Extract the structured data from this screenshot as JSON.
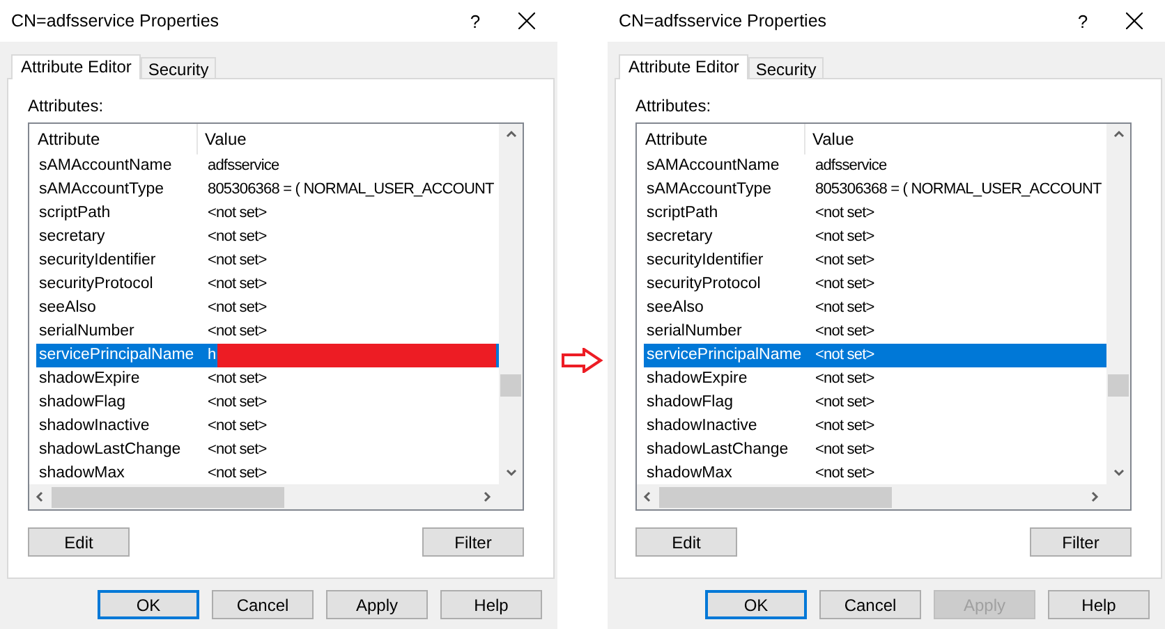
{
  "dialogs": [
    {
      "title": "CN=adfsservice Properties",
      "help": "?",
      "tabs": [
        {
          "label": "Attribute Editor",
          "selected": true
        },
        {
          "label": "Security",
          "selected": false
        }
      ],
      "attributes_label": "Attributes:",
      "columns": [
        "Attribute",
        "Value"
      ],
      "rows": [
        {
          "attribute": "sAMAccountName",
          "value": "adfsservice",
          "selected": false
        },
        {
          "attribute": "sAMAccountType",
          "value": "805306368 = ( NORMAL_USER_ACCOUNT",
          "selected": false
        },
        {
          "attribute": "scriptPath",
          "value": "<not set>",
          "selected": false
        },
        {
          "attribute": "secretary",
          "value": "<not set>",
          "selected": false
        },
        {
          "attribute": "securityIdentifier",
          "value": "<not set>",
          "selected": false
        },
        {
          "attribute": "securityProtocol",
          "value": "<not set>",
          "selected": false
        },
        {
          "attribute": "seeAlso",
          "value": "<not set>",
          "selected": false
        },
        {
          "attribute": "serialNumber",
          "value": "<not set>",
          "selected": false
        },
        {
          "attribute": "servicePrincipalName",
          "value": "h",
          "selected": true,
          "redacted": true
        },
        {
          "attribute": "shadowExpire",
          "value": "<not set>",
          "selected": false
        },
        {
          "attribute": "shadowFlag",
          "value": "<not set>",
          "selected": false
        },
        {
          "attribute": "shadowInactive",
          "value": "<not set>",
          "selected": false
        },
        {
          "attribute": "shadowLastChange",
          "value": "<not set>",
          "selected": false
        },
        {
          "attribute": "shadowMax",
          "value": "<not set>",
          "selected": false
        }
      ],
      "list_buttons": [
        "Edit",
        "Filter"
      ],
      "footer_buttons": [
        {
          "label": "OK",
          "default": true,
          "disabled": false
        },
        {
          "label": "Cancel",
          "default": false,
          "disabled": false
        },
        {
          "label": "Apply",
          "default": false,
          "disabled": false
        },
        {
          "label": "Help",
          "default": false,
          "disabled": false
        }
      ]
    },
    {
      "title": "CN=adfsservice Properties",
      "help": "?",
      "tabs": [
        {
          "label": "Attribute Editor",
          "selected": true
        },
        {
          "label": "Security",
          "selected": false
        }
      ],
      "attributes_label": "Attributes:",
      "columns": [
        "Attribute",
        "Value"
      ],
      "rows": [
        {
          "attribute": "sAMAccountName",
          "value": "adfsservice",
          "selected": false
        },
        {
          "attribute": "sAMAccountType",
          "value": "805306368 = ( NORMAL_USER_ACCOUNT",
          "selected": false
        },
        {
          "attribute": "scriptPath",
          "value": "<not set>",
          "selected": false
        },
        {
          "attribute": "secretary",
          "value": "<not set>",
          "selected": false
        },
        {
          "attribute": "securityIdentifier",
          "value": "<not set>",
          "selected": false
        },
        {
          "attribute": "securityProtocol",
          "value": "<not set>",
          "selected": false
        },
        {
          "attribute": "seeAlso",
          "value": "<not set>",
          "selected": false
        },
        {
          "attribute": "serialNumber",
          "value": "<not set>",
          "selected": false
        },
        {
          "attribute": "servicePrincipalName",
          "value": "<not set>",
          "selected": true
        },
        {
          "attribute": "shadowExpire",
          "value": "<not set>",
          "selected": false
        },
        {
          "attribute": "shadowFlag",
          "value": "<not set>",
          "selected": false
        },
        {
          "attribute": "shadowInactive",
          "value": "<not set>",
          "selected": false
        },
        {
          "attribute": "shadowLastChange",
          "value": "<not set>",
          "selected": false
        },
        {
          "attribute": "shadowMax",
          "value": "<not set>",
          "selected": false
        }
      ],
      "list_buttons": [
        "Edit",
        "Filter"
      ],
      "footer_buttons": [
        {
          "label": "OK",
          "default": true,
          "disabled": false
        },
        {
          "label": "Cancel",
          "default": false,
          "disabled": false
        },
        {
          "label": "Apply",
          "default": false,
          "disabled": true
        },
        {
          "label": "Help",
          "default": false,
          "disabled": false
        }
      ]
    }
  ]
}
